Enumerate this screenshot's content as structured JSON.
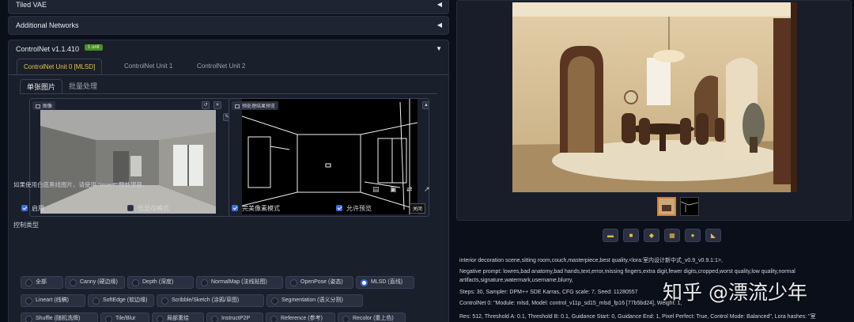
{
  "left": {
    "accordions": [
      {
        "title": "Tiled VAE",
        "arrow": "◀"
      },
      {
        "title": "Additional Networks",
        "arrow": "◀"
      }
    ],
    "controlnet": {
      "title": "ControlNet v1.1.410",
      "badge": "1 unit",
      "arrow": "▼",
      "unit_tabs": [
        "ControlNet Unit 0 [MLSD]",
        "ControlNet Unit 1",
        "ControlNet Unit 2"
      ],
      "sub_tabs": [
        "单张图片",
        "批量处理"
      ],
      "image_label": "图像",
      "preview_label": "预处理结果预览",
      "close_label": "关闭",
      "hint": "如果使用白底黑线图片，请使用 \"invert\" 预处理器。",
      "checkboxes": [
        {
          "label": "启用",
          "checked": true
        },
        {
          "label": "低显存模式",
          "checked": false
        },
        {
          "label": "完美像素模式",
          "checked": true
        },
        {
          "label": "允许预览",
          "checked": true
        }
      ],
      "control_type_label": "控制类型",
      "control_types": [
        {
          "label": "全部",
          "selected": false
        },
        {
          "label": "Canny (硬边缘)",
          "selected": false
        },
        {
          "label": "Depth (深度)",
          "selected": false
        },
        {
          "label": "NormalMap (法线贴图)",
          "selected": false
        },
        {
          "label": "OpenPose (姿态)",
          "selected": false
        },
        {
          "label": "MLSD (直线)",
          "selected": true
        },
        {
          "label": "Lineart (线稿)",
          "selected": false
        },
        {
          "label": "SoftEdge (软边缘)",
          "selected": false
        },
        {
          "label": "Scribble/Sketch (涂鸦/草图)",
          "selected": false
        },
        {
          "label": "Segmentation (语义分割)",
          "selected": false
        },
        {
          "label": "Shuffle (随机洗牌)",
          "selected": false
        },
        {
          "label": "Tile/Blur",
          "selected": false
        },
        {
          "label": "局部重绘",
          "selected": false
        },
        {
          "label": "InstructP2P",
          "selected": false
        },
        {
          "label": "Reference (参考)",
          "selected": false
        },
        {
          "label": "Recolor (重上色)",
          "selected": false
        }
      ]
    }
  },
  "right": {
    "info": [
      "interior decoration scene,sitting room,couch,masterpiece,best quality,<lora:室内设计新中式_v0.9_v0.9.1:1>,",
      "Negative prompt: lowres,bad anatomy,bad hands,text,error,missing fingers,extra digit,fewer digits,cropped,worst quality,low quality,normal",
      "artifacts,signature,watermark,username,blurry,",
      "Steps: 30, Sampler: DPM++ SDE Karras, CFG scale: 7, Seed: 11280557",
      "ControlNet 0: \"Module: mlsd, Model: control_v11p_sd15_mlsd_fp16 [77b5bd24], Weight: 1,",
      "Res: 512, Threshold A: 0.1, Threshold B: 0.1, Guidance Start: 0, Guidance End: 1, Pixel Perfect: True, Control Mode: Balanced\", Lora hashes: \"室"
    ],
    "watermark": "知乎 @漂流少年"
  }
}
